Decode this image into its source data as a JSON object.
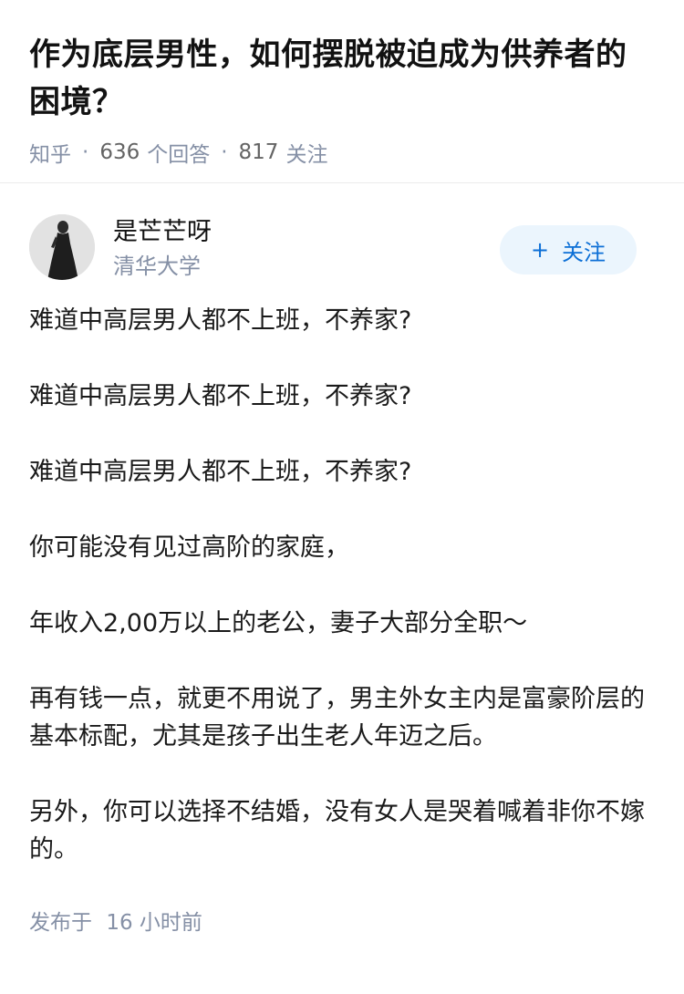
{
  "question": {
    "title": "作为底层男性，如何摆脱被迫成为供养者的困境？",
    "site": "知乎",
    "answer_count": "636",
    "answer_count_label": "个回答",
    "follower_count": "817",
    "follower_count_label": "关注"
  },
  "author": {
    "name": "是芒芒呀",
    "school": "清华大学",
    "follow_label": "关注",
    "follow_icon": "plus-icon"
  },
  "answer": {
    "paragraphs": [
      "难道中高层男人都不上班，不养家?",
      "难道中高层男人都不上班，不养家?",
      "难道中高层男人都不上班，不养家?",
      "你可能没有见过高阶的家庭，",
      "年收入2,00万以上的老公，妻子大部分全职～",
      "再有钱一点，就更不用说了，男主外女主内是富豪阶层的基本标配，尤其是孩子出生老人年迈之后。",
      "另外，你可以选择不结婚，没有女人是哭着喊着非你不嫁的。"
    ],
    "published_label": "发布于",
    "published_time": "16 小时前"
  },
  "colors": {
    "meta": "#8590a6",
    "follow_bg": "#ebf5fd",
    "follow_text": "#0c6fd6"
  }
}
